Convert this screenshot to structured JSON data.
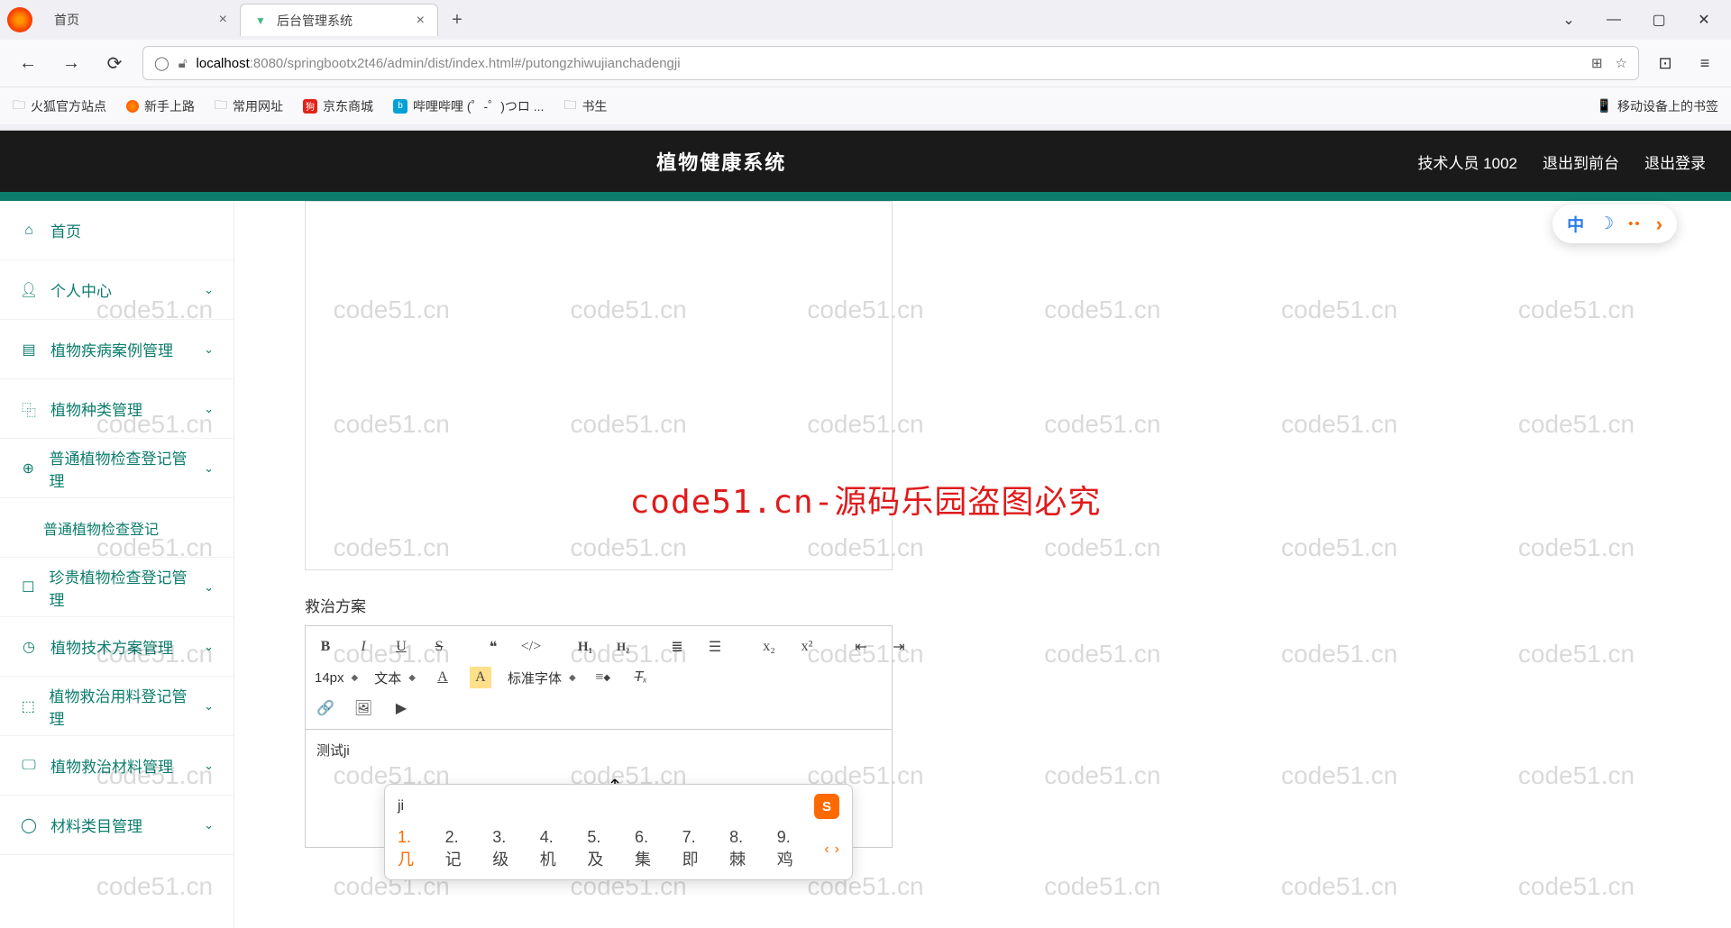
{
  "browser": {
    "tabs": [
      {
        "label": "首页",
        "active": false
      },
      {
        "label": "后台管理系统",
        "active": true
      }
    ],
    "url_host": "localhost",
    "url_path": ":8080/springbootx2t46/admin/dist/index.html#/putongzhiwujianchadengji",
    "bookmarks": {
      "firefox_site": "火狐官方站点",
      "newbie": "新手上路",
      "common": "常用网址",
      "jd": "京东商城",
      "bilibili": "哔哩哔哩 (゜-゜)つロ ...",
      "shusheng": "书生",
      "mobile": "移动设备上的书签"
    }
  },
  "header": {
    "title": "植物健康系统",
    "user": "技术人员 1002",
    "to_front": "退出到前台",
    "logout": "退出登录"
  },
  "sidebar": {
    "items": [
      {
        "icon": "home",
        "label": "首页",
        "expandable": false
      },
      {
        "icon": "user",
        "label": "个人中心",
        "expandable": true
      },
      {
        "icon": "doc",
        "label": "植物疾病案例管理",
        "expandable": true
      },
      {
        "icon": "copy",
        "label": "植物种类管理",
        "expandable": true
      },
      {
        "icon": "target",
        "label": "普通植物检查登记管理",
        "expandable": true
      },
      {
        "icon": "",
        "label": "普通植物检查登记",
        "expandable": false,
        "sub": true
      },
      {
        "icon": "square",
        "label": "珍贵植物检查登记管理",
        "expandable": true
      },
      {
        "icon": "clock",
        "label": "植物技术方案管理",
        "expandable": true
      },
      {
        "icon": "cube",
        "label": "植物救治用料登记管理",
        "expandable": true
      },
      {
        "icon": "monitor",
        "label": "植物救治材料管理",
        "expandable": true
      },
      {
        "icon": "o",
        "label": "材料类目管理",
        "expandable": true
      }
    ]
  },
  "form": {
    "section_label": "救治方案",
    "font_size": "14px",
    "text_type": "文本",
    "font_family": "标准字体",
    "content": "测试ji"
  },
  "ime": {
    "input": "ji",
    "candidates": [
      "1.几",
      "2.记",
      "3.级",
      "4.机",
      "5.及",
      "6.集",
      "7.即",
      "8.棘",
      "9.鸡"
    ]
  },
  "floating_ime": {
    "lang": "中"
  },
  "watermark": {
    "text": "code51.cn",
    "center": "code51.cn-源码乐园盗图必究"
  }
}
